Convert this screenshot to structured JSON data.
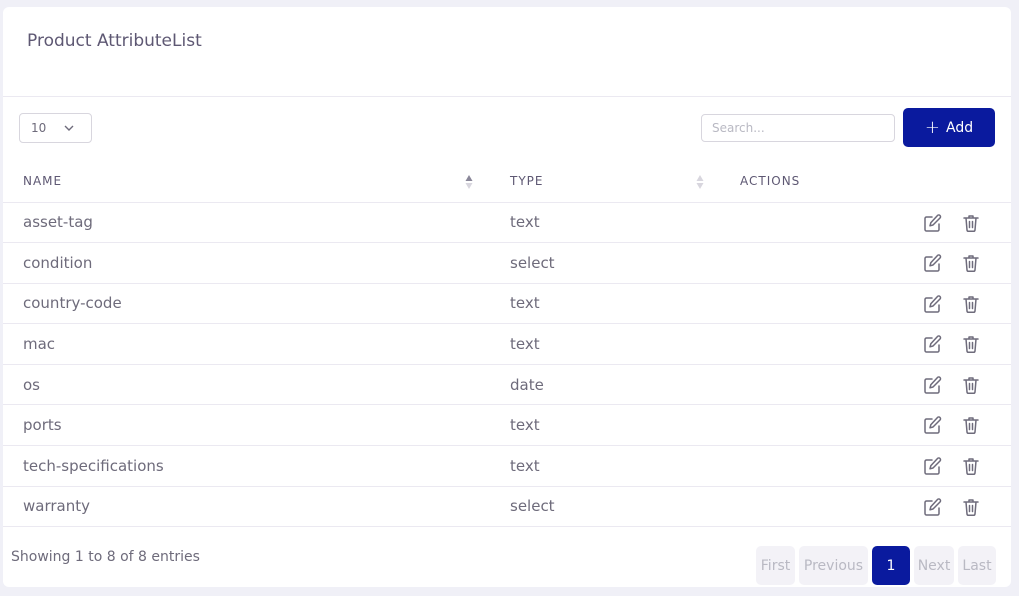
{
  "header": {
    "title": "Product AttributeList"
  },
  "toolbar": {
    "page_length": "10",
    "search_placeholder": "Search...",
    "add_label": "Add"
  },
  "table": {
    "columns": [
      "NAME",
      "TYPE",
      "ACTIONS"
    ],
    "rows": [
      {
        "name": "asset-tag",
        "type": "text"
      },
      {
        "name": "condition",
        "type": "select"
      },
      {
        "name": "country-code",
        "type": "text"
      },
      {
        "name": "mac",
        "type": "text"
      },
      {
        "name": "os",
        "type": "date"
      },
      {
        "name": "ports",
        "type": "text"
      },
      {
        "name": "tech-specifications",
        "type": "text"
      },
      {
        "name": "warranty",
        "type": "select"
      }
    ]
  },
  "footer": {
    "info": "Showing 1 to 8 of 8 entries",
    "pagination": {
      "first": "First",
      "previous": "Previous",
      "current": "1",
      "next": "Next",
      "last": "Last"
    }
  },
  "icons": {
    "edit": "edit-icon",
    "delete": "trash-icon",
    "add": "plus-icon",
    "sort": "sort-icon",
    "dropdown": "chevron-down-icon"
  },
  "colors": {
    "primary": "#0a1a9e",
    "text": "#6e6b7b",
    "heading": "#5e5873",
    "border": "#ebe9f1"
  }
}
